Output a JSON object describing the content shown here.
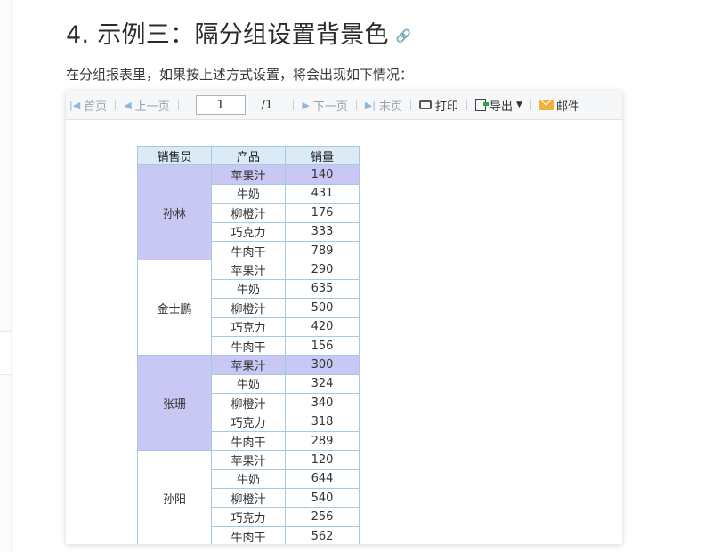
{
  "page": {
    "heading": "4. 示例三：隔分组设置背景色",
    "heading_icon": "link-icon",
    "paragraph": "在分组报表里，如果按上述方式设置，将会出现如下情况："
  },
  "toolbar": {
    "first_label": "首页",
    "prev_label": "上一页",
    "page_value": "1",
    "page_total": "/1",
    "next_label": "下一页",
    "last_label": "末页",
    "print_label": "打印",
    "export_label": "导出",
    "mail_label": "邮件"
  },
  "colors": {
    "highlight": "#c9c8f4",
    "header_bg": "#dbeaf7",
    "border": "#a7c7e7"
  },
  "table": {
    "headers": [
      "销售员",
      "产品",
      "销量"
    ],
    "groups": [
      {
        "salesperson": "孙林",
        "highlight": true,
        "rows": [
          {
            "product": "苹果汁",
            "qty": "140"
          },
          {
            "product": "牛奶",
            "qty": "431"
          },
          {
            "product": "柳橙汁",
            "qty": "176"
          },
          {
            "product": "巧克力",
            "qty": "333"
          },
          {
            "product": "牛肉干",
            "qty": "789"
          }
        ]
      },
      {
        "salesperson": "金士鹏",
        "highlight": false,
        "rows": [
          {
            "product": "苹果汁",
            "qty": "290"
          },
          {
            "product": "牛奶",
            "qty": "635"
          },
          {
            "product": "柳橙汁",
            "qty": "500"
          },
          {
            "product": "巧克力",
            "qty": "420"
          },
          {
            "product": "牛肉干",
            "qty": "156"
          }
        ]
      },
      {
        "salesperson": "张珊",
        "highlight": true,
        "rows": [
          {
            "product": "苹果汁",
            "qty": "300"
          },
          {
            "product": "牛奶",
            "qty": "324"
          },
          {
            "product": "柳橙汁",
            "qty": "340"
          },
          {
            "product": "巧克力",
            "qty": "318"
          },
          {
            "product": "牛肉干",
            "qty": "289"
          }
        ]
      },
      {
        "salesperson": "孙阳",
        "highlight": false,
        "rows": [
          {
            "product": "苹果汁",
            "qty": "120"
          },
          {
            "product": "牛奶",
            "qty": "644"
          },
          {
            "product": "柳橙汁",
            "qty": "540"
          },
          {
            "product": "巧克力",
            "qty": "256"
          },
          {
            "product": "牛肉干",
            "qty": "562"
          }
        ]
      }
    ]
  }
}
